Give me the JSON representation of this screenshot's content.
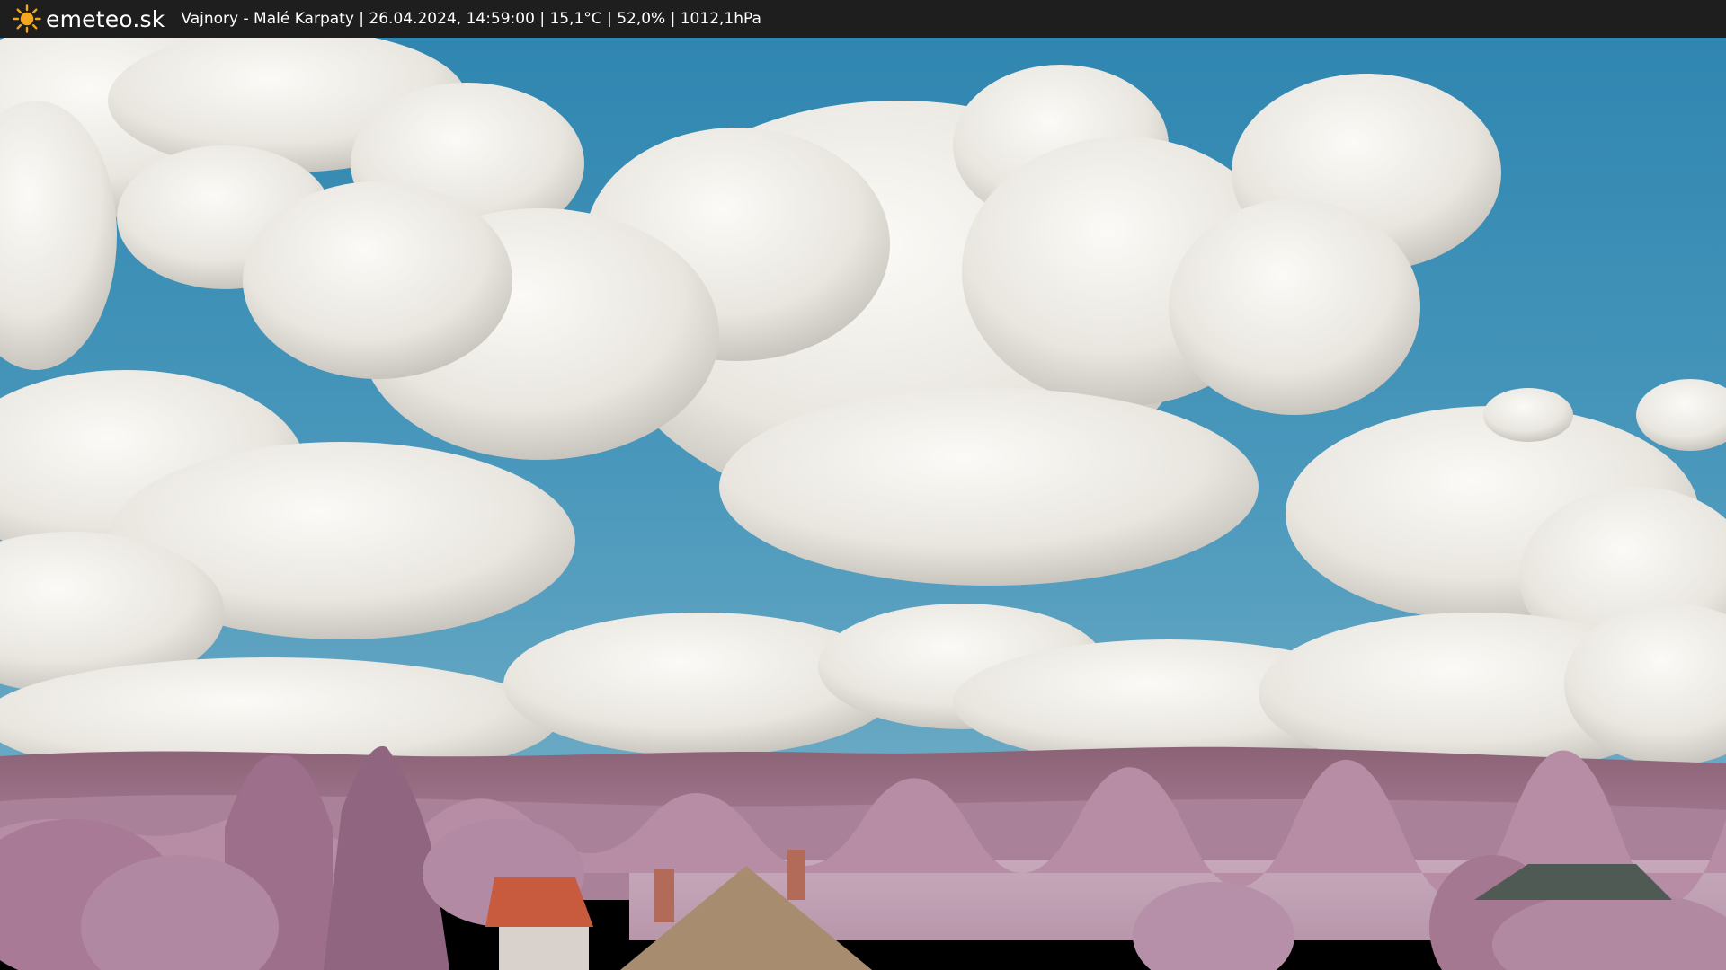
{
  "header": {
    "brand": "emeteo.sk",
    "caption": "Vajnory - Malé Karpaty | 26.04.2024, 14:59:00 | 15,1°C | 52,0% | 1012,1hPa"
  },
  "colors": {
    "bar_background": "#1e1e1e",
    "sun": "#f2a81d",
    "sky": "#3f8fb5",
    "cloud": "#f1efea",
    "hills": "#a37892",
    "foliage": "#b78ea6",
    "roof_tiles": "#a88c6f",
    "red_roof": "#c85a3e"
  },
  "icons": [
    "sun-icon"
  ],
  "scene": {
    "description_icons": [
      "sky",
      "clouds",
      "hills",
      "trees",
      "rooftops"
    ]
  }
}
